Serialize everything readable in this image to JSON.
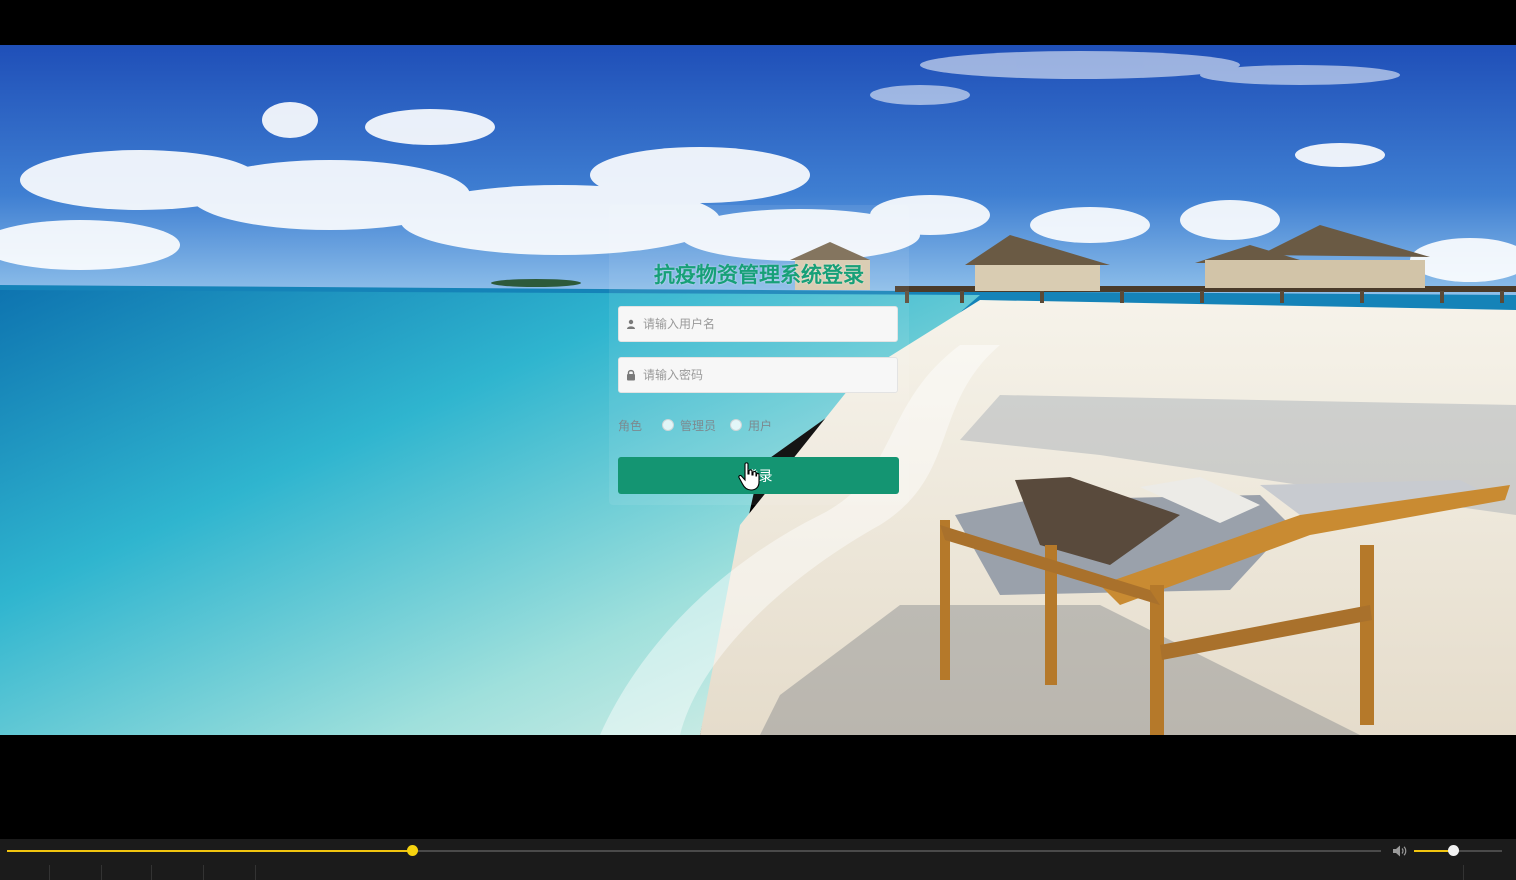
{
  "login": {
    "title": "抗疫物资管理系统登录",
    "username_placeholder": "请输入用户名",
    "password_placeholder": "请输入密码",
    "role_label": "角色",
    "role_options": [
      "管理员",
      "用户"
    ],
    "submit_label": "登录"
  },
  "player": {
    "progress": 0.2948,
    "volume": 0.44
  },
  "colors": {
    "accent": "#149572",
    "title": "#17a078",
    "progress": "#f1c40f"
  },
  "icons": {
    "username": "user-icon",
    "password": "lock-icon",
    "volume": "volume-icon"
  }
}
